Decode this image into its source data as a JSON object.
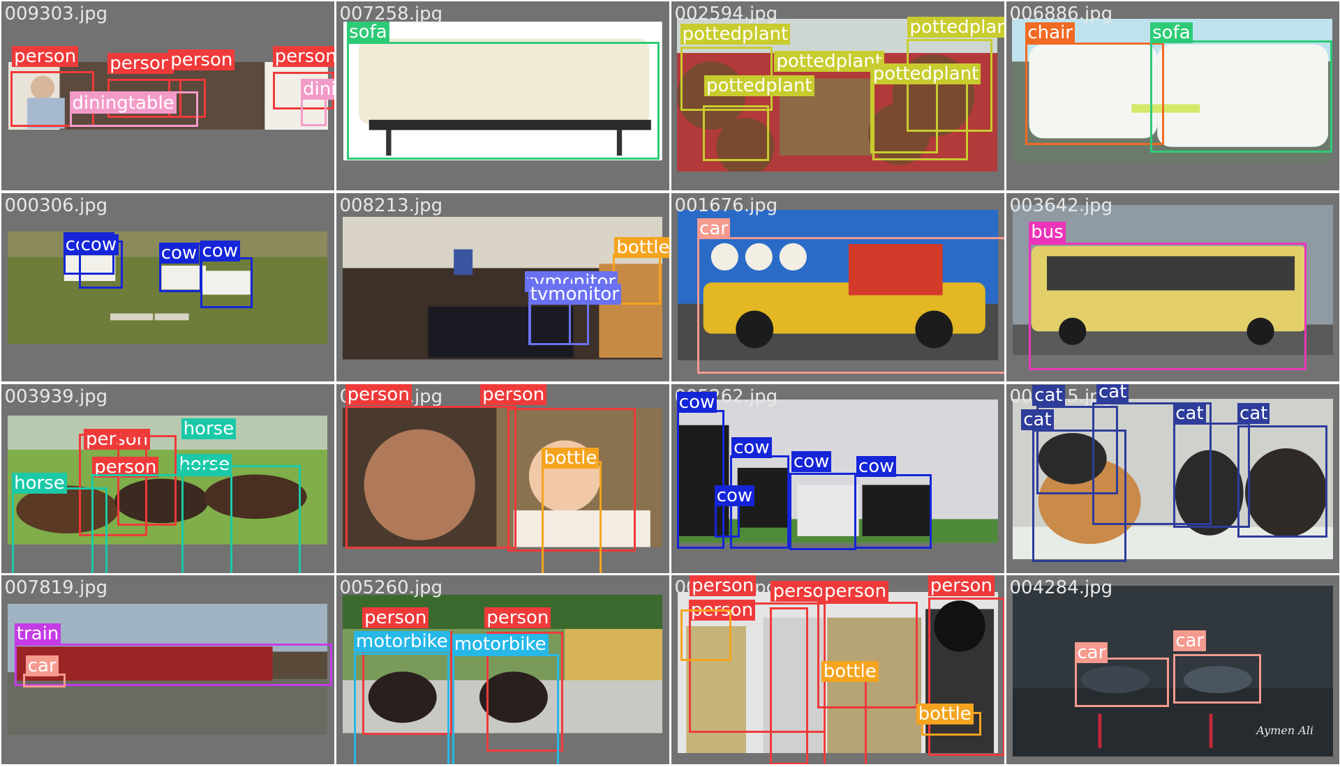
{
  "colors": {
    "person": "#ef3a3a",
    "diningtable": "#f39bc8",
    "sofa": "#2ecb77",
    "pottedplant": "#c8cc2e",
    "chair": "#f06a24",
    "cow": "#1525d8",
    "bottle": "#f5a41f",
    "tvmonitor": "#6a72f2",
    "car": "#f59a8e",
    "bus": "#ea35b8",
    "horse": "#1bc9a8",
    "cat": "#2e3c9a",
    "train": "#c43be6",
    "motorbike": "#27b8e8"
  },
  "tiles": [
    {
      "filename": "009303.jpg",
      "detections": [
        {
          "label": "person",
          "cls": "person"
        },
        {
          "label": "person",
          "cls": "person"
        },
        {
          "label": "person",
          "cls": "person"
        },
        {
          "label": "person",
          "cls": "person"
        },
        {
          "label": "diningtable",
          "cls": "diningtable"
        },
        {
          "label": "diningtable",
          "cls": "diningtable"
        }
      ]
    },
    {
      "filename": "007258.jpg",
      "detections": [
        {
          "label": "sofa",
          "cls": "sofa"
        }
      ]
    },
    {
      "filename": "002594.jpg",
      "detections": [
        {
          "label": "pottedplant",
          "cls": "pottedplant"
        },
        {
          "label": "pottedplant",
          "cls": "pottedplant"
        },
        {
          "label": "pottedplant",
          "cls": "pottedplant"
        },
        {
          "label": "pottedplant",
          "cls": "pottedplant"
        },
        {
          "label": "pottedplant",
          "cls": "pottedplant"
        }
      ]
    },
    {
      "filename": "006886.jpg",
      "detections": [
        {
          "label": "chair",
          "cls": "chair"
        },
        {
          "label": "sofa",
          "cls": "sofa"
        }
      ]
    },
    {
      "filename": "000306.jpg",
      "detections": [
        {
          "label": "cow",
          "cls": "cow"
        },
        {
          "label": "cow",
          "cls": "cow"
        },
        {
          "label": "cow",
          "cls": "cow"
        },
        {
          "label": "cow",
          "cls": "cow"
        }
      ]
    },
    {
      "filename": "008213.jpg",
      "detections": [
        {
          "label": "bottle",
          "cls": "bottle"
        },
        {
          "label": "tvmonitor",
          "cls": "tvmonitor"
        },
        {
          "label": "tvmonitor",
          "cls": "tvmonitor"
        }
      ]
    },
    {
      "filename": "001676.jpg",
      "detections": [
        {
          "label": "car",
          "cls": "car"
        }
      ]
    },
    {
      "filename": "003642.jpg",
      "detections": [
        {
          "label": "bus",
          "cls": "bus"
        }
      ]
    },
    {
      "filename": "003939.jpg",
      "detections": [
        {
          "label": "person",
          "cls": "person"
        },
        {
          "label": "person",
          "cls": "person"
        },
        {
          "label": "horse",
          "cls": "horse"
        },
        {
          "label": "horse",
          "cls": "horse"
        },
        {
          "label": "horse",
          "cls": "horse"
        }
      ]
    },
    {
      "filename": "000932.jpg",
      "detections": [
        {
          "label": "person",
          "cls": "person"
        },
        {
          "label": "person",
          "cls": "person"
        },
        {
          "label": "bottle",
          "cls": "bottle"
        }
      ]
    },
    {
      "filename": "005262.jpg",
      "detections": [
        {
          "label": "cow",
          "cls": "cow"
        },
        {
          "label": "cow",
          "cls": "cow"
        },
        {
          "label": "cow",
          "cls": "cow"
        },
        {
          "label": "cow",
          "cls": "cow"
        },
        {
          "label": "cow",
          "cls": "cow"
        }
      ]
    },
    {
      "filename": "002015.jpg",
      "detections": [
        {
          "label": "cat",
          "cls": "cat"
        },
        {
          "label": "cat",
          "cls": "cat"
        },
        {
          "label": "cat",
          "cls": "cat"
        },
        {
          "label": "cat",
          "cls": "cat"
        },
        {
          "label": "cat",
          "cls": "cat"
        }
      ]
    },
    {
      "filename": "007819.jpg",
      "detections": [
        {
          "label": "train",
          "cls": "train"
        },
        {
          "label": "car",
          "cls": "car"
        }
      ]
    },
    {
      "filename": "005260.jpg",
      "detections": [
        {
          "label": "person",
          "cls": "person"
        },
        {
          "label": "person",
          "cls": "person"
        },
        {
          "label": "motorbike",
          "cls": "motorbike"
        },
        {
          "label": "motorbike",
          "cls": "motorbike"
        }
      ]
    },
    {
      "filename": "003384.jpg",
      "detections": [
        {
          "label": "person",
          "cls": "person"
        },
        {
          "label": "person",
          "cls": "person"
        },
        {
          "label": "person",
          "cls": "person"
        },
        {
          "label": "person",
          "cls": "person"
        },
        {
          "label": "person",
          "cls": "person"
        },
        {
          "label": "bottle",
          "cls": "bottle"
        },
        {
          "label": "bottle",
          "cls": "bottle"
        }
      ]
    },
    {
      "filename": "004284.jpg",
      "detections": [
        {
          "label": "car",
          "cls": "car"
        },
        {
          "label": "car",
          "cls": "car"
        }
      ],
      "watermark": "Aymen Ali"
    }
  ]
}
